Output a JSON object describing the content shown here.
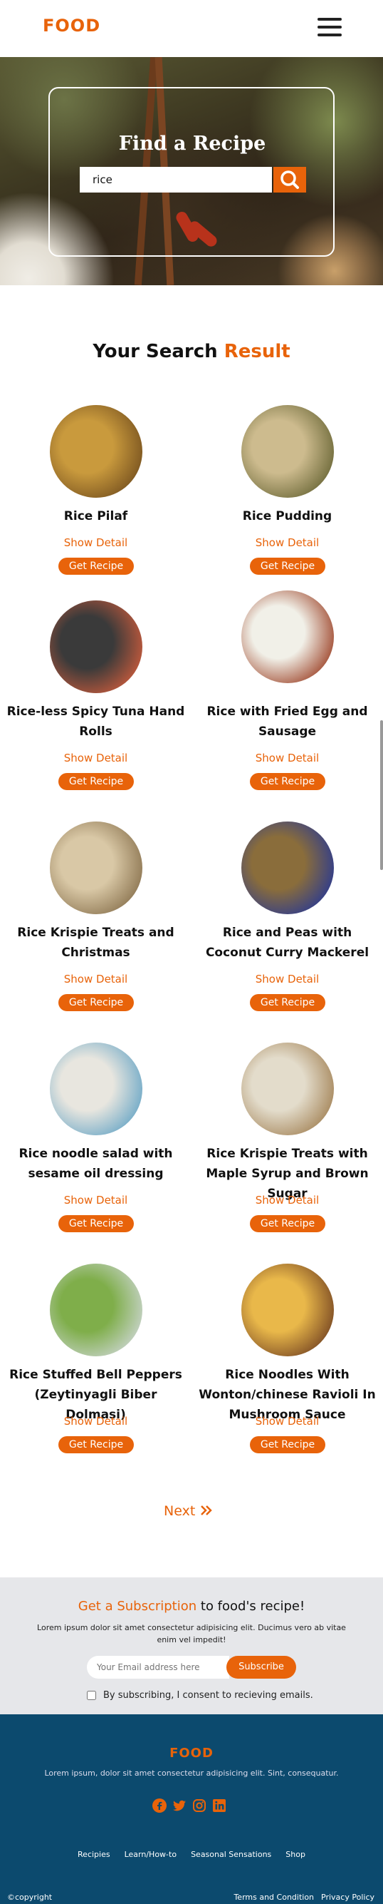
{
  "header": {
    "logo": "FOOD"
  },
  "hero": {
    "title": "Find a Recipe",
    "search_value": "rice"
  },
  "results": {
    "title_main": "Your Search ",
    "title_accent": "Result",
    "show_detail": "Show Detail",
    "get_recipe": "Get Recipe",
    "items": [
      {
        "title": "Rice Pilaf",
        "thumb": [
          "#c99a3d",
          "#7a5420"
        ]
      },
      {
        "title": "Rice Pudding",
        "thumb": [
          "#cdbb8e",
          "#6e6a3a"
        ]
      },
      {
        "title": "Rice-less Spicy Tuna Hand Rolls",
        "thumb": [
          "#3a3a3a",
          "#c45a3c"
        ]
      },
      {
        "title": "Rice with Fried Egg and Sausage",
        "thumb": [
          "#f1f0e8",
          "#a04a30"
        ]
      },
      {
        "title": "Rice Krispie Treats and Christmas",
        "thumb": [
          "#d9c8a6",
          "#8d7652"
        ]
      },
      {
        "title": "Rice and Peas with Coconut Curry Mackerel",
        "thumb": [
          "#8a6d3b",
          "#2d3b8e"
        ]
      },
      {
        "title": "Rice noodle salad with sesame oil dressing",
        "thumb": [
          "#e8e6df",
          "#6fa9c7"
        ]
      },
      {
        "title": "Rice Krispie Treats with Maple Syrup and Brown Sugar",
        "thumb": [
          "#e3dccb",
          "#a6875c"
        ]
      },
      {
        "title": "Rice Stuffed Bell Peppers (Zeytinyagli Biber Dolmasi)",
        "thumb": [
          "#7fae4a",
          "#c7d3c9"
        ]
      },
      {
        "title": "Rice Noodles With Wonton/chinese Ravioli In Mushroom Sauce",
        "thumb": [
          "#e9b84a",
          "#7b4a24"
        ]
      }
    ]
  },
  "pagination": {
    "next": "Next"
  },
  "subscribe": {
    "title_accent": "Get a Subscription",
    "title_rest": " to food's recipe!",
    "text": "Lorem ipsum dolor sit amet consectetur adipisicing elit. Ducimus vero ab vitae enim vel impedit!",
    "placeholder": "Your Email address here",
    "button": "Subscribe",
    "consent": "By subscribing, I consent to recieving emails."
  },
  "footer": {
    "logo": "FOOD",
    "text": "Lorem ipsum, dolor sit amet consectetur adipisicing elit. Sint, consequatur.",
    "social": [
      "facebook-icon",
      "twitter-icon",
      "instagram-icon",
      "linkedin-icon"
    ],
    "nav": [
      "Recipies",
      "Learn/How-to",
      "Seasonal Sensations",
      "Shop"
    ],
    "copyright": "©copyright",
    "links": [
      "Terms and Condition",
      "Privacy Policy"
    ]
  },
  "colors": {
    "accent": "#e8630a",
    "footer_bg": "#0c4a6e",
    "subscribe_bg": "#e6e7ea"
  }
}
